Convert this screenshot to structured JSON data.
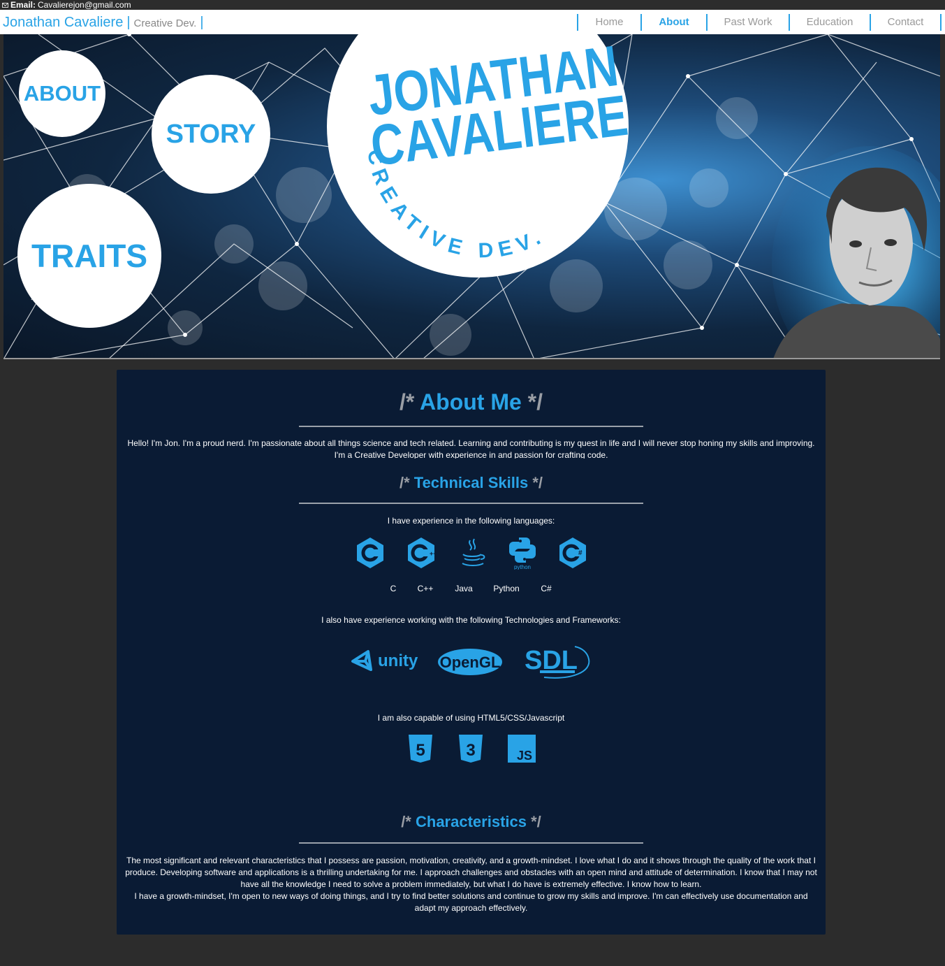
{
  "email_bar": {
    "label": "Email:",
    "address": "Cavalierejon@gmail.com"
  },
  "header": {
    "brand_name": "Jonathan Cavaliere",
    "separator": "|",
    "tagline": "Creative Dev.",
    "nav": [
      {
        "label": "Home",
        "active": false
      },
      {
        "label": "About",
        "active": true
      },
      {
        "label": "Past Work",
        "active": false
      },
      {
        "label": "Education",
        "active": false
      },
      {
        "label": "Contact",
        "active": false
      }
    ]
  },
  "hero": {
    "circles": {
      "about": "ABOUT",
      "story": "STORY",
      "traits": "TRAITS"
    },
    "logo_line1": "JONATHAN",
    "logo_line2": "CAVALIERE",
    "logo_ring": "CREATIVE DEV."
  },
  "about": {
    "title_open": "/*",
    "title": "About Me",
    "title_close": "*/",
    "text": "Hello! I'm Jon. I'm a proud nerd. I'm passionate about all things science and tech related. Learning and contributing is my quest in life and I will never stop honing my skills and improving. I'm a Creative Developer with experience in and passion for crafting code."
  },
  "skills": {
    "title_open": "/*",
    "title": "Technical Skills",
    "title_close": "*/",
    "languages_intro": "I have experience in the following languages:",
    "languages": [
      {
        "name": "C",
        "icon": "c-language-icon"
      },
      {
        "name": "C++",
        "icon": "cpp-language-icon"
      },
      {
        "name": "Java",
        "icon": "java-icon"
      },
      {
        "name": "Python",
        "icon": "python-icon"
      },
      {
        "name": "C#",
        "icon": "csharp-icon"
      }
    ],
    "python_wordmark": "python",
    "frameworks_intro": "I also have experience working with the following Technologies and Frameworks:",
    "frameworks": [
      {
        "name": "unity",
        "icon": "unity-logo"
      },
      {
        "name": "OpenGL",
        "icon": "opengl-logo"
      },
      {
        "name": "SDL",
        "icon": "sdl-logo"
      }
    ],
    "web_intro": "I am also capable of using HTML5/CSS/Javascript",
    "web": [
      {
        "name": "HTML5",
        "icon": "html5-icon",
        "glyph": "5"
      },
      {
        "name": "CSS3",
        "icon": "css3-icon",
        "glyph": "3"
      },
      {
        "name": "JavaScript",
        "icon": "javascript-icon",
        "glyph": "JS"
      }
    ]
  },
  "characteristics": {
    "title_open": "/*",
    "title": "Characteristics",
    "title_close": "*/",
    "text1": "The most significant and relevant characteristics that I possess are passion, motivation, creativity, and a growth-mindset. I love what I do and it shows through the quality of the work that I produce. Developing software and applications is a thrilling undertaking for me. I approach challenges and obstacles with an open mind and attitude of determination. I know that I may not have all the knowledge I need to solve a problem immediately, but what I do have is extremely effective. I know how to learn.",
    "text2": "I have a growth-mindset, I'm open to new ways of doing things, and I try to find better solutions and continue to grow my skills and improve. I'm can effectively use documentation and adapt my approach effectively."
  },
  "colors": {
    "accent": "#29a3e6",
    "card": "#0a1b34",
    "page": "#2c2c2c"
  }
}
